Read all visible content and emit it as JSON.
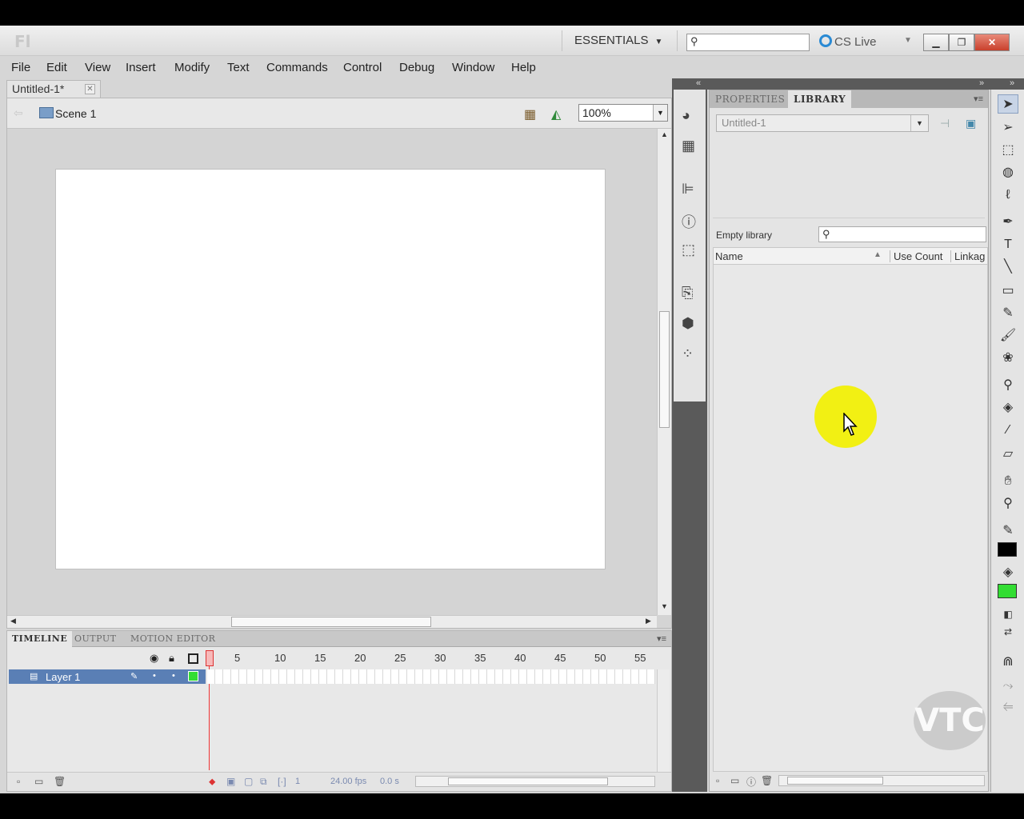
{
  "app": {
    "logo": "Fl",
    "workspace": "ESSENTIALS",
    "cs_live": "CS Live"
  },
  "menu": [
    "File",
    "Edit",
    "View",
    "Insert",
    "Modify",
    "Text",
    "Commands",
    "Control",
    "Debug",
    "Window",
    "Help"
  ],
  "document": {
    "tab_title": "Untitled-1*",
    "scene": "Scene 1",
    "zoom": "100%"
  },
  "timeline": {
    "tabs": [
      "TIMELINE",
      "OUTPUT",
      "MOTION EDITOR"
    ],
    "frame_numbers": [
      "1",
      "5",
      "10",
      "15",
      "20",
      "25",
      "30",
      "35",
      "40",
      "45",
      "50",
      "55"
    ],
    "layer_name": "Layer 1",
    "current_frame": "1",
    "fps": "24.00 fps",
    "time": "0.0 s"
  },
  "library": {
    "tabs": [
      "PROPERTIES",
      "LIBRARY"
    ],
    "document": "Untitled-1",
    "empty_label": "Empty library",
    "columns": [
      "Name",
      "Use Count",
      "Linkag"
    ]
  },
  "colors": {
    "stroke": "#000000",
    "fill": "#33dd33",
    "accent_layer": "#5a7fb5"
  },
  "watermark": "VTC"
}
